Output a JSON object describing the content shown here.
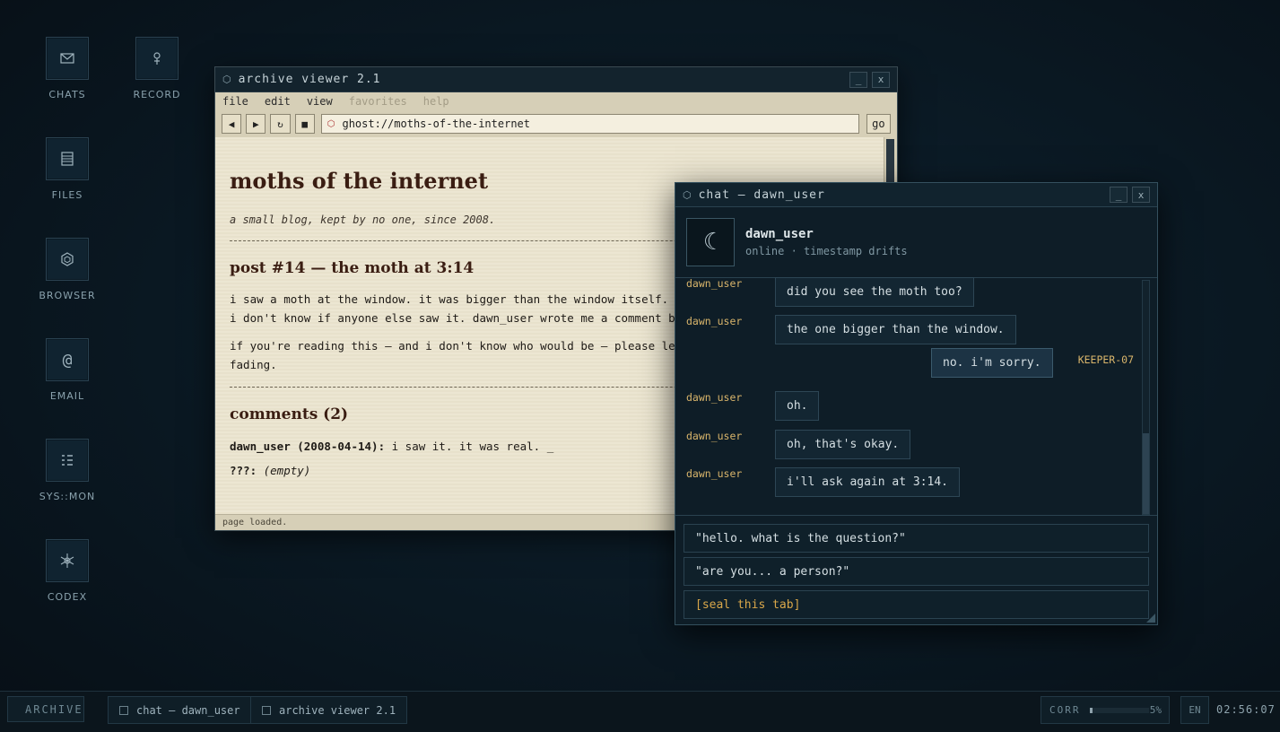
{
  "desktop": {
    "icons": [
      {
        "label": "CHATS",
        "icon": "envelope-icon"
      },
      {
        "label": "RECORD",
        "icon": "record-pin-icon"
      },
      {
        "label": "FILES",
        "icon": "files-icon"
      },
      {
        "label": "BROWSER",
        "icon": "hexagon-icon"
      },
      {
        "label": "EMAIL",
        "icon": "at-sign-icon"
      },
      {
        "label": "SYS::MON",
        "icon": "list-icon"
      },
      {
        "label": "CODEX",
        "icon": "snowflake-icon"
      }
    ]
  },
  "browser": {
    "title": "archive viewer 2.1",
    "minimize": "_",
    "close": "x",
    "menu": [
      "file",
      "edit",
      "view",
      "favorites",
      "help"
    ],
    "nav": {
      "back": "◀",
      "forward": "▶",
      "reload": "↻",
      "stop": "■"
    },
    "url": "ghost://moths-of-the-internet",
    "go": "go",
    "page": {
      "title": "moths of the internet",
      "subtitle": "a small blog, kept by no one, since 2008.",
      "post_title": "post #14 — the moth at 3:14",
      "p1_line1": "i saw a moth at the window. it was bigger than the window itself.",
      "p1_line2": "i don't know if anyone else saw it. dawn_user wrote me a comment bu",
      "p2_line1": "if you're reading this — and i don't know who would be — please lea",
      "p2_line2": "fading.",
      "comments_title": "comments (2)",
      "comment1_author": "dawn_user (2008-04-14):",
      "comment1_text": " i saw it. it was real. _",
      "comment2_author": "???:",
      "comment2_text": " (empty)"
    },
    "status": "page loaded."
  },
  "chat": {
    "title": "chat — dawn_user",
    "minimize": "_",
    "close": "x",
    "avatar_glyph": "☾",
    "contact_name": "dawn_user",
    "contact_status": "online · timestamp drifts",
    "messages": [
      {
        "sender": "dawn_user",
        "text": "did you see the moth too?",
        "me": false
      },
      {
        "sender": "dawn_user",
        "text": "the one bigger than the window.",
        "me": false
      },
      {
        "sender": "KEEPER-07",
        "text": "no. i'm sorry.",
        "me": true
      },
      {
        "sender": "dawn_user",
        "text": "oh.",
        "me": false
      },
      {
        "sender": "dawn_user",
        "text": "oh, that's okay.",
        "me": false
      },
      {
        "sender": "dawn_user",
        "text": "i'll ask again at 3:14.",
        "me": false
      }
    ],
    "replies": [
      "\"hello. what is the question?\"",
      "\"are you... a person?\"",
      "[seal this tab]"
    ]
  },
  "taskbar": {
    "archive": "ARCHIVE",
    "tab1": "chat — dawn_user",
    "tab2": "archive viewer 2.1",
    "corr_label": "CORR",
    "corr_value": "5%",
    "corr_fraction": 0.05,
    "lang": "EN",
    "clock": "02:56:07"
  },
  "colors": {
    "accent": "#d9b56b",
    "seal": "#d9a74a",
    "paper": "#ece6d2",
    "panel": "#0e1d27"
  }
}
